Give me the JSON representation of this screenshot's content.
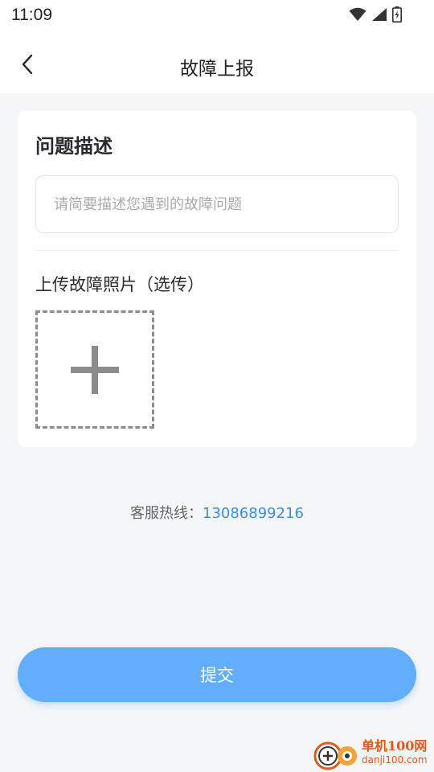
{
  "status_bar": {
    "time": "11:09"
  },
  "nav": {
    "title": "故障上报"
  },
  "form": {
    "section_title": "问题描述",
    "description": {
      "value": "",
      "placeholder": "请简要描述您遇到的故障问题"
    },
    "upload_label": "上传故障照片（选传）"
  },
  "hotline": {
    "label": "客服热线：",
    "number": "13086899216"
  },
  "submit": {
    "label": "提交"
  },
  "watermark": {
    "title": "单机100网",
    "url": "danji100.com"
  },
  "colors": {
    "accent": "#63aefc",
    "link": "#3e8de6",
    "background": "#f5f6f8"
  }
}
